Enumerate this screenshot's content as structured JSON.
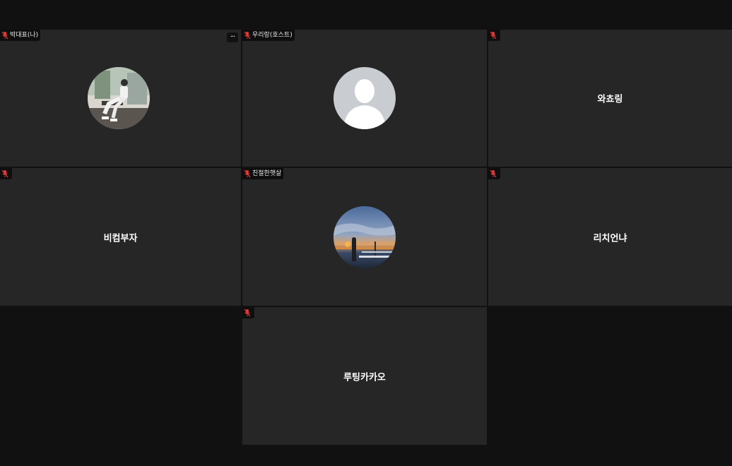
{
  "participants": [
    {
      "tag": "박대표(나)",
      "center_name": ""
    },
    {
      "tag": "우리랑(호스트)",
      "center_name": ""
    },
    {
      "tag": "",
      "center_name": "와쵸링"
    },
    {
      "tag": "",
      "center_name": "비컴부자"
    },
    {
      "tag": "친절한햇살",
      "center_name": ""
    },
    {
      "tag": "",
      "center_name": "리치언냐"
    },
    {
      "tag": "",
      "center_name": "루팅카카오"
    }
  ],
  "controls": {
    "more_label": "···"
  },
  "colors": {
    "muted_mic": "#e53935",
    "tile_bg": "#262626",
    "page_bg": "#111111"
  }
}
